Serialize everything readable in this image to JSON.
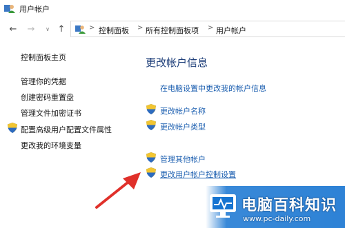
{
  "window": {
    "title": "用户帐户",
    "icon": "user-accounts-icon"
  },
  "navigation": {
    "back": "←",
    "forward": "→",
    "recent": "∨",
    "up": "↑",
    "breadcrumb": [
      "控制面板",
      "所有控制面板项",
      "用户帐户"
    ],
    "separator": ">"
  },
  "sidebar": {
    "home": "控制面板主页",
    "items": [
      {
        "label": "管理你的凭据",
        "icon": ""
      },
      {
        "label": "创建密码重置盘",
        "icon": ""
      },
      {
        "label": "管理文件加密证书",
        "icon": ""
      },
      {
        "label": "配置高级用户配置文件属性",
        "icon": "shield-icon"
      },
      {
        "label": "更改我的环境变量",
        "icon": ""
      }
    ]
  },
  "main": {
    "heading": "更改帐户信息",
    "pc_settings_link": "在电脑设置中更改我的帐户信息",
    "actions": [
      {
        "label": "更改帐户名称",
        "icon": "shield-icon"
      },
      {
        "label": "更改帐户类型",
        "icon": "shield-icon"
      },
      {
        "label": "管理其他帐户",
        "icon": "shield-icon"
      },
      {
        "label": "更改用户帐户控制设置",
        "icon": "shield-icon"
      }
    ]
  },
  "watermark": {
    "title": "电脑百科知识",
    "url": "www.pc-daily.com"
  },
  "colors": {
    "link": "#1c5fb0",
    "heading": "#1e3f7a",
    "annotation_arrow": "#e0302a",
    "watermark_bg": "#1674d1"
  }
}
